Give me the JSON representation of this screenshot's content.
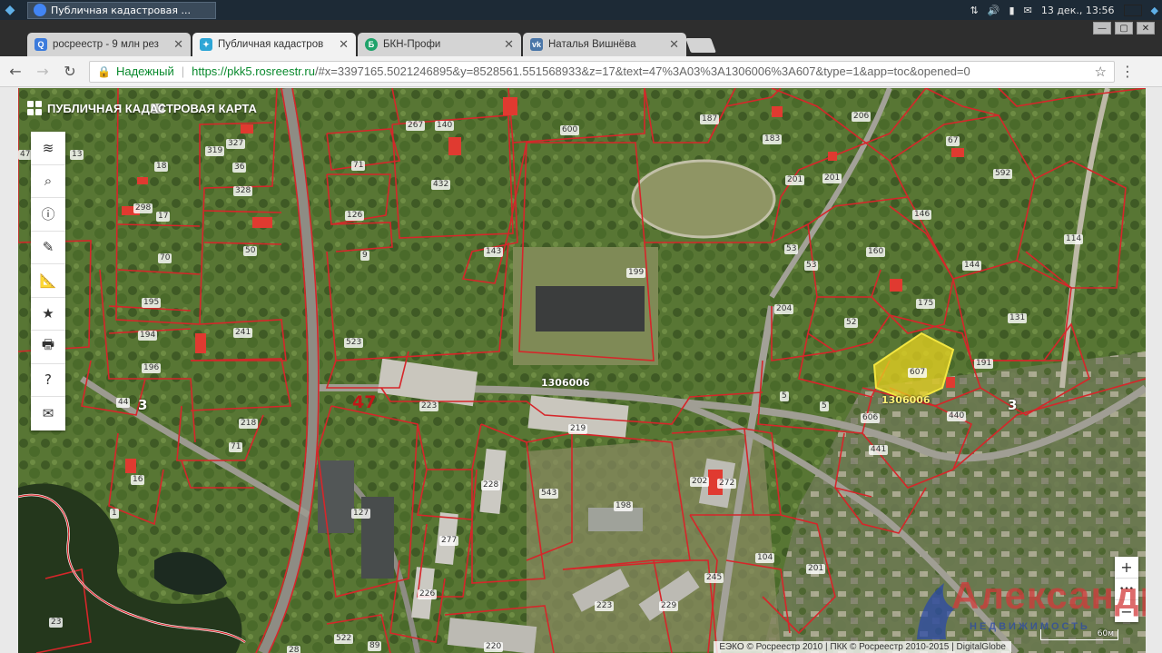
{
  "os": {
    "window_task_title": "Публичная кадастровая ...",
    "clock": "13 дек., 13:56",
    "flag_colors": [
      "#ffffff",
      "#0039a6",
      "#d52b1e"
    ]
  },
  "browser": {
    "tabs": [
      {
        "title": "росреестр - 9 млн рез",
        "favicon": "search-favicon",
        "favicon_color": "#3c7bdc",
        "favicon_glyph": "Q"
      },
      {
        "title": "Публичная кадастров",
        "favicon": "pkk-favicon",
        "favicon_color": "#2ea6d6",
        "favicon_glyph": "✦",
        "active": true
      },
      {
        "title": "БКН-Профи",
        "favicon": "bkn-favicon",
        "favicon_color": "#1fa36b",
        "favicon_glyph": "Б"
      },
      {
        "title": "Наталья Вишнёва",
        "favicon": "vk-favicon",
        "favicon_color": "#4a76a8",
        "favicon_glyph": "vk"
      }
    ],
    "secure_label": "Надежный",
    "url_host": "https://pkk5.rosreestr.ru",
    "url_rest": "/#x=3397165.5021246895&y=8528561.551568933&z=17&text=47%3A03%3A1306006%3A607&type=1&app=toc&opened=0"
  },
  "map": {
    "title": "ПУБЛИЧНАЯ КАДАСТРОВАЯ КАРТА",
    "district_label": "47",
    "quarter_labels": [
      "1306006",
      "1306006"
    ],
    "region_labels": [
      "3",
      "3"
    ],
    "plot_numbers": [
      "19",
      "47",
      "13",
      "319",
      "327",
      "36",
      "18",
      "328",
      "298",
      "17",
      "70",
      "50",
      "71",
      "126",
      "9",
      "432",
      "267",
      "140",
      "600",
      "187",
      "183",
      "206",
      "67",
      "592",
      "201",
      "201",
      "146",
      "160",
      "114",
      "143",
      "199",
      "53",
      "53",
      "144",
      "175",
      "131",
      "52",
      "195",
      "194",
      "241",
      "523",
      "204",
      "607",
      "191",
      "196",
      "44",
      "218",
      "71",
      "223",
      "219",
      "5",
      "5",
      "606",
      "440",
      "441",
      "228",
      "543",
      "198",
      "202",
      "272",
      "127",
      "277",
      "226",
      "223",
      "229",
      "245",
      "104",
      "201",
      "23",
      "28",
      "522",
      "89",
      "220",
      "16",
      "1"
    ],
    "zoom_in": "+",
    "zoom_more": "•••",
    "zoom_out": "−",
    "scale_label": "60м",
    "attribution": "ЕЭКО © Росреестр 2010 | ПКК © Росреестр 2010-2015 | DigitalGlobe",
    "watermark_text": "Александр",
    "watermark_sub": "НЕДВИЖИМОСТЬ",
    "selected_fill": "#e8d320",
    "boundary_color": "#d6262a",
    "tools": [
      "layers-icon",
      "search-icon",
      "info-icon",
      "pencil-icon",
      "ruler-icon",
      "star-icon",
      "print-icon",
      "help-icon",
      "mail-icon"
    ]
  }
}
